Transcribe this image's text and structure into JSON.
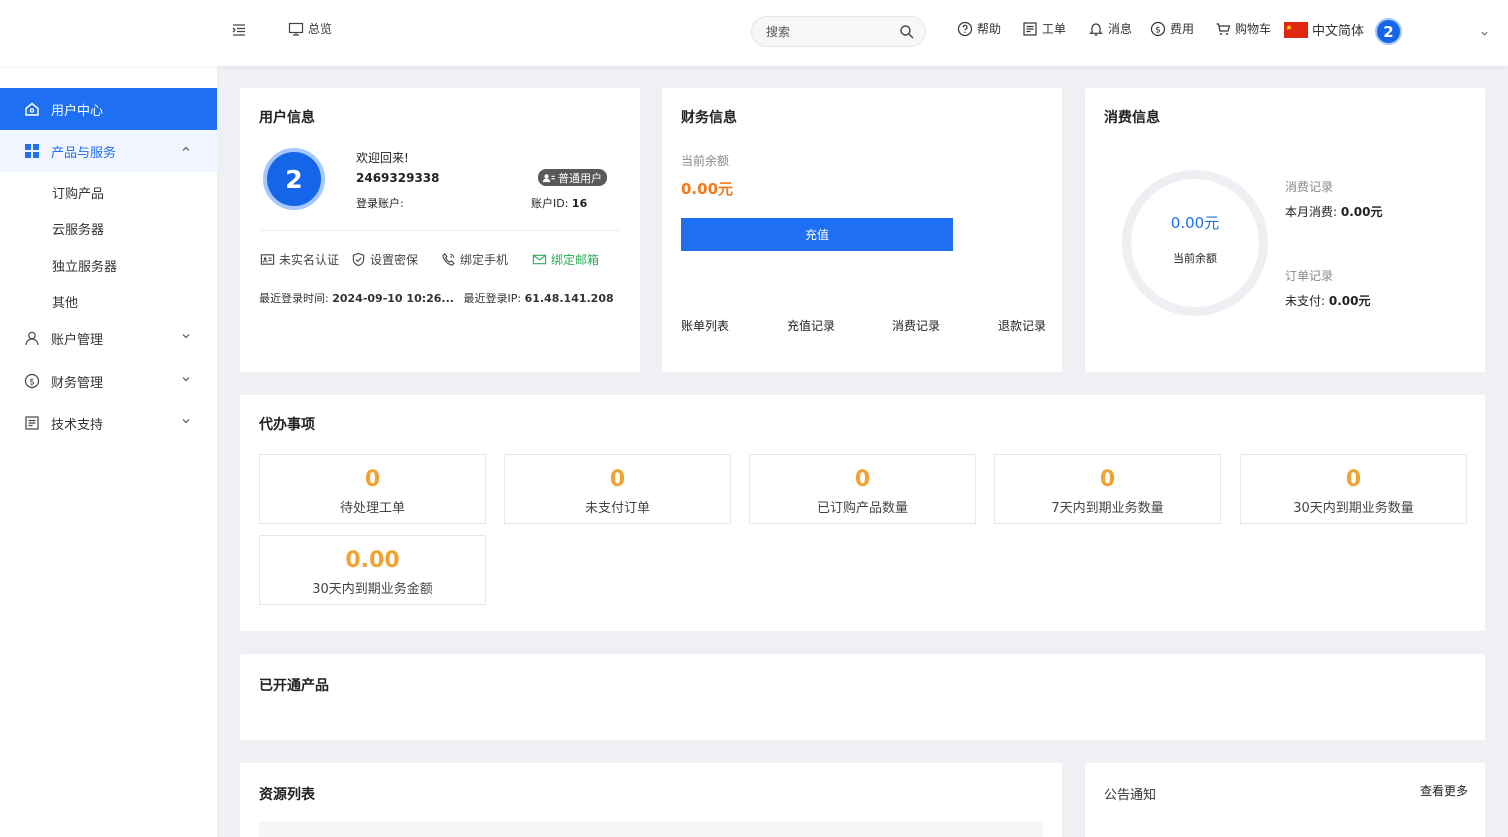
{
  "header": {
    "overview_label": "总览",
    "search_placeholder": "搜索",
    "help_label": "帮助",
    "ticket_label": "工单",
    "message_label": "消息",
    "fee_label": "费用",
    "cart_label": "购物车",
    "language_label": "中文简体",
    "avatar_text": "2"
  },
  "sidebar": {
    "items": [
      {
        "label": "用户中心",
        "icon": "home-icon"
      },
      {
        "label": "产品与服务",
        "icon": "grid-icon"
      },
      {
        "label": "账户管理",
        "icon": "user-icon"
      },
      {
        "label": "财务管理",
        "icon": "dollar-icon"
      },
      {
        "label": "技术支持",
        "icon": "document-icon"
      }
    ],
    "sub_items": [
      "订购产品",
      "云服务器",
      "独立服务器",
      "其他"
    ]
  },
  "user_info": {
    "title": "用户信息",
    "avatar_text": "2",
    "welcome": "欢迎回来!",
    "username": "2469329338",
    "login_account_label": "登录账户:",
    "badge": "普通用户",
    "account_id_label": "账户ID:",
    "account_id": "16",
    "actions": [
      "未实名认证",
      "设置密保",
      "绑定手机",
      "绑定邮箱"
    ],
    "last_login_time_label": "最近登录时间:",
    "last_login_time": "2024-09-10 10:26...",
    "last_login_ip_label": "最近登录IP:",
    "last_login_ip": "61.48.141.208"
  },
  "finance": {
    "title": "财务信息",
    "balance_label": "当前余额",
    "balance": "0.00元",
    "recharge_button": "充值",
    "links": [
      "账单列表",
      "充值记录",
      "消费记录",
      "退款记录"
    ]
  },
  "consumption": {
    "title": "消费信息",
    "ring_value": "0.00元",
    "ring_label": "当前余额",
    "consume_record_label": "消费记录",
    "month_consume_label": "本月消费:",
    "month_consume_value": "0.00元",
    "order_record_label": "订单记录",
    "unpaid_label": "未支付:",
    "unpaid_value": "0.00元"
  },
  "todo": {
    "title": "代办事项",
    "tiles": [
      {
        "value": "0",
        "label": "待处理工单"
      },
      {
        "value": "0",
        "label": "未支付订单"
      },
      {
        "value": "0",
        "label": "已订购产品数量"
      },
      {
        "value": "0",
        "label": "7天内到期业务数量"
      },
      {
        "value": "0",
        "label": "30天内到期业务数量"
      },
      {
        "value": "0.00",
        "label": "30天内到期业务金额"
      }
    ]
  },
  "opened_products": {
    "title": "已开通产品"
  },
  "resources": {
    "title": "资源列表"
  },
  "notice": {
    "title": "公告通知",
    "more_link": "查看更多"
  },
  "colors": {
    "primary": "#1f6ff2",
    "accent_orange": "#f27a1a",
    "tile_number": "#f0a332",
    "email_green": "#2dab5a"
  }
}
